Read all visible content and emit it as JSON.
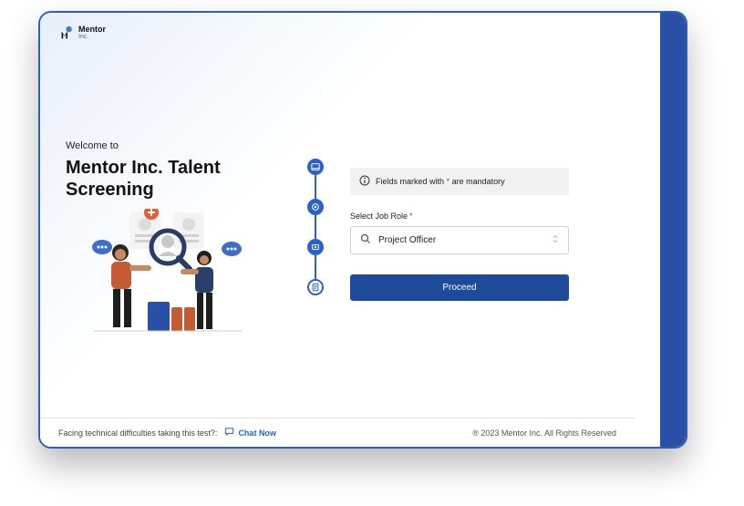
{
  "brand": {
    "name": "Mentor",
    "suffix": "Inc."
  },
  "left": {
    "welcome": "Welcome to",
    "title": "Mentor Inc. Talent Screening"
  },
  "notice": {
    "prefix": "Fields marked with",
    "asterisk": "*",
    "suffix": "are mandatory"
  },
  "form": {
    "job_role_label": "Select Job Role",
    "job_role_required": "*",
    "job_role_value": "Project Officer",
    "proceed_label": "Proceed"
  },
  "footer": {
    "difficulty_text": "Facing technical difficulties taking this test?:",
    "chat_label": "Chat Now",
    "copyright": "® 2023 Mentor Inc. All Rights Reserved"
  },
  "colors": {
    "primary": "#2a4fa6",
    "accent": "#2a62c9"
  }
}
